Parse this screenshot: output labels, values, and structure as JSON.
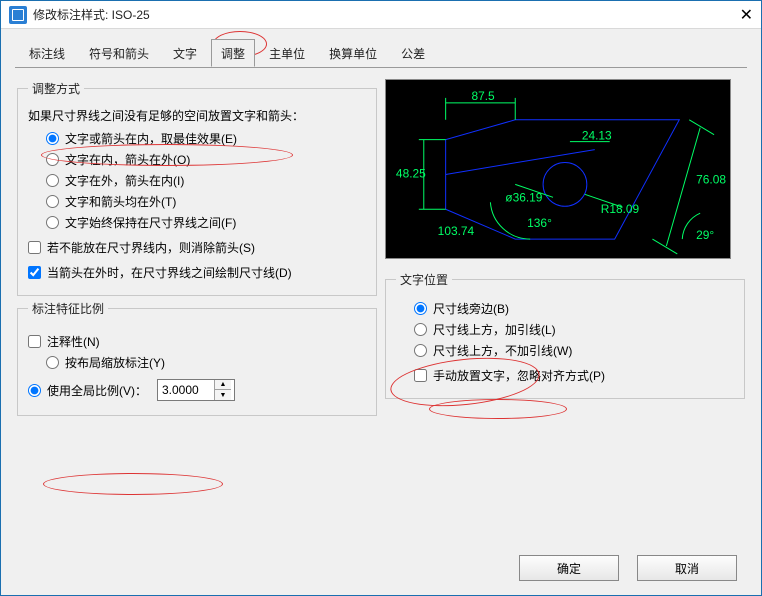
{
  "window": {
    "title": "修改标注样式: ISO-25"
  },
  "tabs": [
    "标注线",
    "符号和箭头",
    "文字",
    "调整",
    "主单位",
    "换算单位",
    "公差"
  ],
  "activeTab": 3,
  "fit": {
    "legend": "调整方式",
    "lead": "如果尺寸界线之间没有足够的空间放置文字和箭头：",
    "options": [
      "文字或箭头在内，取最佳效果(E)",
      "文字在内，箭头在外(O)",
      "文字在外，箭头在内(I)",
      "文字和箭头均在外(T)",
      "文字始终保持在尺寸界线之间(F)"
    ],
    "selected": 0,
    "chk1": "若不能放在尺寸界线内，则消除箭头(S)",
    "chk1_on": false,
    "chk2": "当箭头在外时，在尺寸界线之间绘制尺寸线(D)",
    "chk2_on": true
  },
  "feature": {
    "legend": "标注特征比例",
    "annot": "注释性(N)",
    "annot_on": false,
    "layout": "按布局缩放标注(Y)",
    "global": "使用全局比例(V)：",
    "which": "global",
    "scale": "3.0000"
  },
  "txtpos": {
    "legend": "文字位置",
    "options": [
      "尺寸线旁边(B)",
      "尺寸线上方，加引线(L)",
      "尺寸线上方，不加引线(W)"
    ],
    "selected": 0,
    "manual": "手动放置文字，忽略对齐方式(P)",
    "manual_on": false
  },
  "preview": {
    "dims": {
      "top": "87.5",
      "left": "48.25",
      "mid": "24.13",
      "rad": "R18.09",
      "dia": "ø36.19",
      "ang": "136°",
      "ang2": "29°",
      "btm": "103.74",
      "right": "76.08"
    }
  },
  "buttons": {
    "ok": "确定",
    "cancel": "取消"
  }
}
